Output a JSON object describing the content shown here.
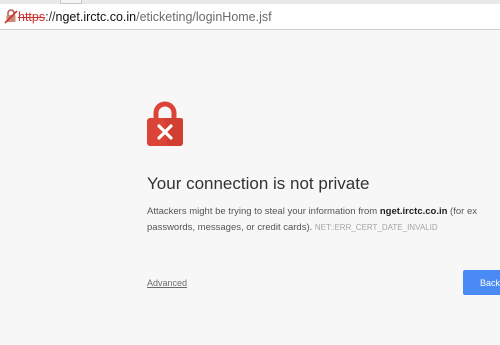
{
  "browser": {
    "address_bar": {
      "scheme": "https",
      "host": "nget.irctc.co.in",
      "path": "/eticketing/loginHome.jsf",
      "security_icon": "broken-lock-icon"
    }
  },
  "interstitial": {
    "icon": "red-lock-x-icon",
    "title": "Your connection is not private",
    "message_prefix": "Attackers might be trying to steal your information from ",
    "message_host": "nget.irctc.co.in",
    "message_suffix": " (for ex",
    "message_line2": "passwords, messages, or credit cards).",
    "error_code": "NET::ERR_CERT_DATE_INVALID",
    "advanced_label": "Advanced",
    "back_button_label": "Back",
    "colors": {
      "icon_red": "#db4437",
      "button_blue": "#4a8af4",
      "insecure_red": "#d0312d"
    }
  }
}
